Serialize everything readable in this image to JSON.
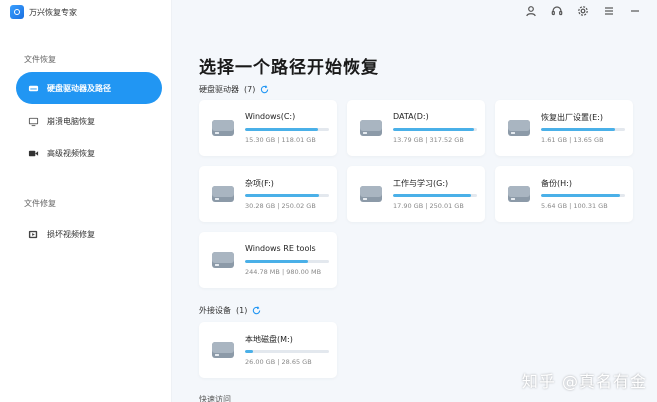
{
  "app": {
    "title": "万兴恢复专家"
  },
  "colors": {
    "accent": "#2196f3",
    "bar_fill": "#4ab0e8",
    "bar_track": "#e3e8ee"
  },
  "sidebar": {
    "section_recover": "文件恢复",
    "section_repair": "文件修复",
    "items": [
      {
        "label": "硬盘驱动器及路径",
        "icon": "hard-drive-icon"
      },
      {
        "label": "崩溃电脑恢复",
        "icon": "crashed-computer-icon"
      },
      {
        "label": "高级视频恢复",
        "icon": "video-camera-icon"
      },
      {
        "label": "损坏视频修复",
        "icon": "video-repair-icon"
      }
    ]
  },
  "topbar": {
    "icons": [
      "user-icon",
      "headset-icon",
      "settings-icon",
      "menu-icon",
      "minimize-icon"
    ]
  },
  "main": {
    "title": "选择一个路径开始恢复",
    "drives_header": "硬盘驱动器",
    "drives_count": "(7)",
    "external_header": "外接设备",
    "external_count": "(1)",
    "bottom_label": "快速访问",
    "drives": [
      {
        "name": "Windows(C:)",
        "size": "15.30 GB | 118.01 GB",
        "used": 0.87
      },
      {
        "name": "DATA(D:)",
        "size": "13.79 GB | 317.52 GB",
        "used": 0.96
      },
      {
        "name": "恢复出厂设置(E:)",
        "size": "1.61 GB | 13.65 GB",
        "used": 0.88
      },
      {
        "name": "杂项(F:)",
        "size": "30.28 GB | 250.02 GB",
        "used": 0.88
      },
      {
        "name": "工作与学习(G:)",
        "size": "17.90 GB | 250.01 GB",
        "used": 0.93
      },
      {
        "name": "备份(H:)",
        "size": "5.64 GB | 100.31 GB",
        "used": 0.94
      },
      {
        "name": "Windows RE tools",
        "size": "244.78 MB | 980.00 MB",
        "used": 0.75
      }
    ],
    "external": [
      {
        "name": "本地磁盘(M:)",
        "size": "26.00 GB | 28.65 GB",
        "used": 0.09
      }
    ]
  },
  "watermark": "知乎 @真名有金"
}
